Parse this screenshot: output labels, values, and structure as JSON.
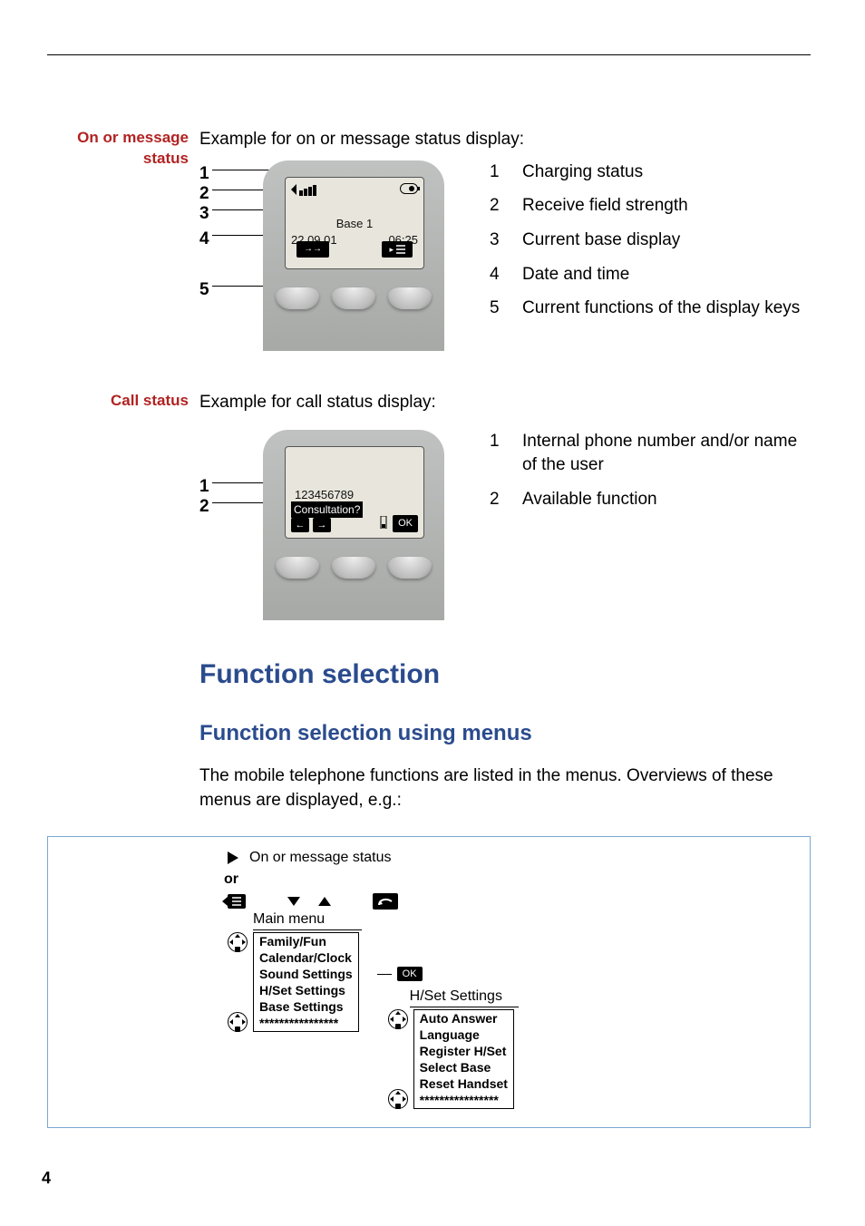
{
  "section1": {
    "side_title_line1": "On or message",
    "side_title_line2": "status",
    "intro": "Example for on or message status display:",
    "callouts": [
      "1",
      "2",
      "3",
      "4",
      "5"
    ],
    "legend": [
      {
        "num": "1",
        "text": "Charging status"
      },
      {
        "num": "2",
        "text": "Receive field strength"
      },
      {
        "num": "3",
        "text": "Current base display"
      },
      {
        "num": "4",
        "text": "Date and time"
      },
      {
        "num": "5",
        "text": "Current functions of the display keys"
      }
    ],
    "screen": {
      "base": "Base 1",
      "date": "22.09.01",
      "time": "06:25"
    }
  },
  "section2": {
    "side_title": "Call status",
    "intro": "Example for call status display:",
    "callouts": [
      "1",
      "2"
    ],
    "legend": [
      {
        "num": "1",
        "text": "Internal phone number and/or name of the user"
      },
      {
        "num": "2",
        "text": "Available function"
      }
    ],
    "screen": {
      "number": "123456789",
      "func": "Consultation?",
      "ok": "OK"
    }
  },
  "headings": {
    "h1": "Function selection",
    "h2": "Function selection using menus"
  },
  "para": "The mobile telephone functions are listed in the menus. Overviews of these menus are displayed, e.g.:",
  "diagram": {
    "top_label": "On or message status",
    "or": "or",
    "main_menu_label": "Main menu",
    "main_menu": [
      "Family/Fun",
      "Calendar/Clock",
      "Sound Settings",
      "H/Set Settings",
      "Base Settings",
      "****************"
    ],
    "ok_label": "OK",
    "sub_label": "H/Set Settings",
    "sub_menu": [
      "Auto Answer",
      "Language",
      "Register H/Set",
      "Select Base",
      "Reset Handset",
      "****************"
    ]
  },
  "page_number": "4"
}
